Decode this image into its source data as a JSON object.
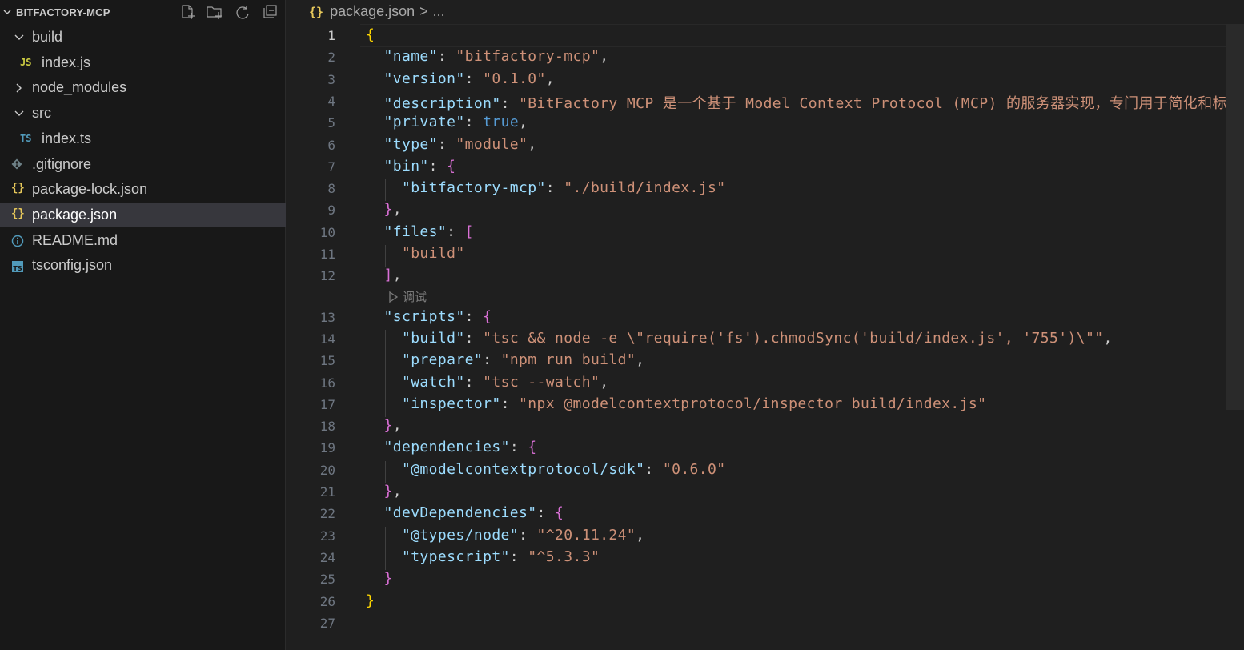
{
  "explorer": {
    "title": "BITFACTORY-MCP",
    "actions": [
      "new-file-icon",
      "new-folder-icon",
      "refresh-icon",
      "collapse-all-icon"
    ],
    "items": [
      {
        "type": "folder",
        "label": "build",
        "expanded": true,
        "depth": 0
      },
      {
        "type": "file",
        "icon": "JS",
        "icon_color": "#cbcb41",
        "label": "index.js",
        "depth": 1
      },
      {
        "type": "folder",
        "label": "node_modules",
        "expanded": false,
        "depth": 0
      },
      {
        "type": "folder",
        "label": "src",
        "expanded": true,
        "depth": 0
      },
      {
        "type": "file",
        "icon": "TS",
        "icon_color": "#519aba",
        "label": "index.ts",
        "depth": 1
      },
      {
        "type": "file",
        "icon": "git-icon",
        "icon_color": "#6d8086",
        "label": ".gitignore",
        "depth": 0
      },
      {
        "type": "file",
        "icon": "{}",
        "icon_color": "#e8c95b",
        "label": "package-lock.json",
        "depth": 0
      },
      {
        "type": "file",
        "icon": "{}",
        "icon_color": "#e8c95b",
        "label": "package.json",
        "depth": 0,
        "selected": true
      },
      {
        "type": "file",
        "icon": "info-icon",
        "icon_color": "#519aba",
        "label": "README.md",
        "depth": 0
      },
      {
        "type": "file",
        "icon": "TS",
        "icon_color": "#519aba",
        "label": "tsconfig.json",
        "depth": 0
      }
    ]
  },
  "breadcrumb": {
    "icon": "{}",
    "file": "package.json",
    "separator": ">",
    "rest": "..."
  },
  "editor": {
    "active_line": 1,
    "codelens_label": "调试",
    "lines": [
      [
        [
          "b1",
          "{"
        ]
      ],
      [
        [
          "p",
          "  "
        ],
        [
          "k",
          "\"name\""
        ],
        [
          "p",
          ": "
        ],
        [
          "s",
          "\"bitfactory-mcp\""
        ],
        [
          "p",
          ","
        ]
      ],
      [
        [
          "p",
          "  "
        ],
        [
          "k",
          "\"version\""
        ],
        [
          "p",
          ": "
        ],
        [
          "s",
          "\"0.1.0\""
        ],
        [
          "p",
          ","
        ]
      ],
      [
        [
          "p",
          "  "
        ],
        [
          "k",
          "\"description\""
        ],
        [
          "p",
          ": "
        ],
        [
          "s",
          "\"BitFactory MCP 是一个基于 Model Context Protocol (MCP) 的服务器实现，专门用于简化和标"
        ]
      ],
      [
        [
          "p",
          "  "
        ],
        [
          "k",
          "\"private\""
        ],
        [
          "p",
          ": "
        ],
        [
          "kw",
          "true"
        ],
        [
          "p",
          ","
        ]
      ],
      [
        [
          "p",
          "  "
        ],
        [
          "k",
          "\"type\""
        ],
        [
          "p",
          ": "
        ],
        [
          "s",
          "\"module\""
        ],
        [
          "p",
          ","
        ]
      ],
      [
        [
          "p",
          "  "
        ],
        [
          "k",
          "\"bin\""
        ],
        [
          "p",
          ": "
        ],
        [
          "b2",
          "{"
        ]
      ],
      [
        [
          "p",
          "    "
        ],
        [
          "k",
          "\"bitfactory-mcp\""
        ],
        [
          "p",
          ": "
        ],
        [
          "s",
          "\"./build/index.js\""
        ]
      ],
      [
        [
          "p",
          "  "
        ],
        [
          "b2",
          "}"
        ],
        [
          "p",
          ","
        ]
      ],
      [
        [
          "p",
          "  "
        ],
        [
          "k",
          "\"files\""
        ],
        [
          "p",
          ": "
        ],
        [
          "b2",
          "["
        ]
      ],
      [
        [
          "p",
          "    "
        ],
        [
          "s",
          "\"build\""
        ]
      ],
      [
        [
          "p",
          "  "
        ],
        [
          "b2",
          "]"
        ],
        [
          "p",
          ","
        ]
      ],
      [
        [
          "p",
          "  "
        ],
        [
          "k",
          "\"scripts\""
        ],
        [
          "p",
          ": "
        ],
        [
          "b2",
          "{"
        ]
      ],
      [
        [
          "p",
          "    "
        ],
        [
          "k",
          "\"build\""
        ],
        [
          "p",
          ": "
        ],
        [
          "s",
          "\"tsc && node -e \\\"require('fs').chmodSync('build/index.js', '755')\\\"\""
        ],
        [
          "p",
          ","
        ]
      ],
      [
        [
          "p",
          "    "
        ],
        [
          "k",
          "\"prepare\""
        ],
        [
          "p",
          ": "
        ],
        [
          "s",
          "\"npm run build\""
        ],
        [
          "p",
          ","
        ]
      ],
      [
        [
          "p",
          "    "
        ],
        [
          "k",
          "\"watch\""
        ],
        [
          "p",
          ": "
        ],
        [
          "s",
          "\"tsc --watch\""
        ],
        [
          "p",
          ","
        ]
      ],
      [
        [
          "p",
          "    "
        ],
        [
          "k",
          "\"inspector\""
        ],
        [
          "p",
          ": "
        ],
        [
          "s",
          "\"npx @modelcontextprotocol/inspector build/index.js\""
        ]
      ],
      [
        [
          "p",
          "  "
        ],
        [
          "b2",
          "}"
        ],
        [
          "p",
          ","
        ]
      ],
      [
        [
          "p",
          "  "
        ],
        [
          "k",
          "\"dependencies\""
        ],
        [
          "p",
          ": "
        ],
        [
          "b2",
          "{"
        ]
      ],
      [
        [
          "p",
          "    "
        ],
        [
          "k",
          "\"@modelcontextprotocol/sdk\""
        ],
        [
          "p",
          ": "
        ],
        [
          "s",
          "\"0.6.0\""
        ]
      ],
      [
        [
          "p",
          "  "
        ],
        [
          "b2",
          "}"
        ],
        [
          "p",
          ","
        ]
      ],
      [
        [
          "p",
          "  "
        ],
        [
          "k",
          "\"devDependencies\""
        ],
        [
          "p",
          ": "
        ],
        [
          "b2",
          "{"
        ]
      ],
      [
        [
          "p",
          "    "
        ],
        [
          "k",
          "\"@types/node\""
        ],
        [
          "p",
          ": "
        ],
        [
          "s",
          "\"^20.11.24\""
        ],
        [
          "p",
          ","
        ]
      ],
      [
        [
          "p",
          "    "
        ],
        [
          "k",
          "\"typescript\""
        ],
        [
          "p",
          ": "
        ],
        [
          "s",
          "\"^5.3.3\""
        ]
      ],
      [
        [
          "p",
          "  "
        ],
        [
          "b2",
          "}"
        ]
      ],
      [
        [
          "b1",
          "}"
        ]
      ],
      []
    ]
  }
}
